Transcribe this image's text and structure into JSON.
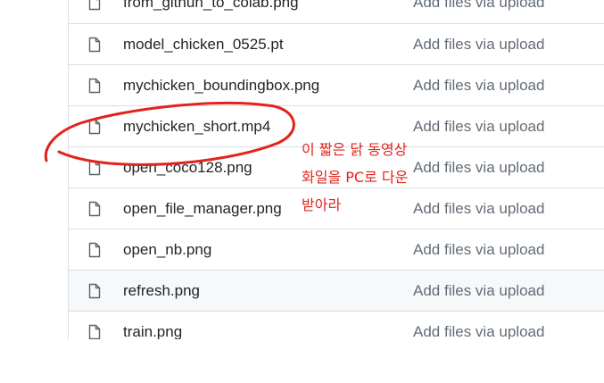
{
  "files": [
    {
      "name": "from_githun_to_colab.png",
      "commit": "Add files via upload"
    },
    {
      "name": "model_chicken_0525.pt",
      "commit": "Add files via upload"
    },
    {
      "name": "mychicken_boundingbox.png",
      "commit": "Add files via upload"
    },
    {
      "name": "mychicken_short.mp4",
      "commit": "Add files via upload"
    },
    {
      "name": "open_coco128.png",
      "commit": "Add files via upload"
    },
    {
      "name": "open_file_manager.png",
      "commit": "Add files via upload"
    },
    {
      "name": "open_nb.png",
      "commit": "Add files via upload"
    },
    {
      "name": "refresh.png",
      "commit": "Add files via upload"
    },
    {
      "name": "train.png",
      "commit": "Add files via upload"
    }
  ],
  "annotation": {
    "lines": [
      "이 짧은 닭 동영상",
      "화일을 PC로 다운",
      "받아라"
    ],
    "color": "#e2231a"
  },
  "icon": "file-icon",
  "hovered_row": "refresh.png"
}
